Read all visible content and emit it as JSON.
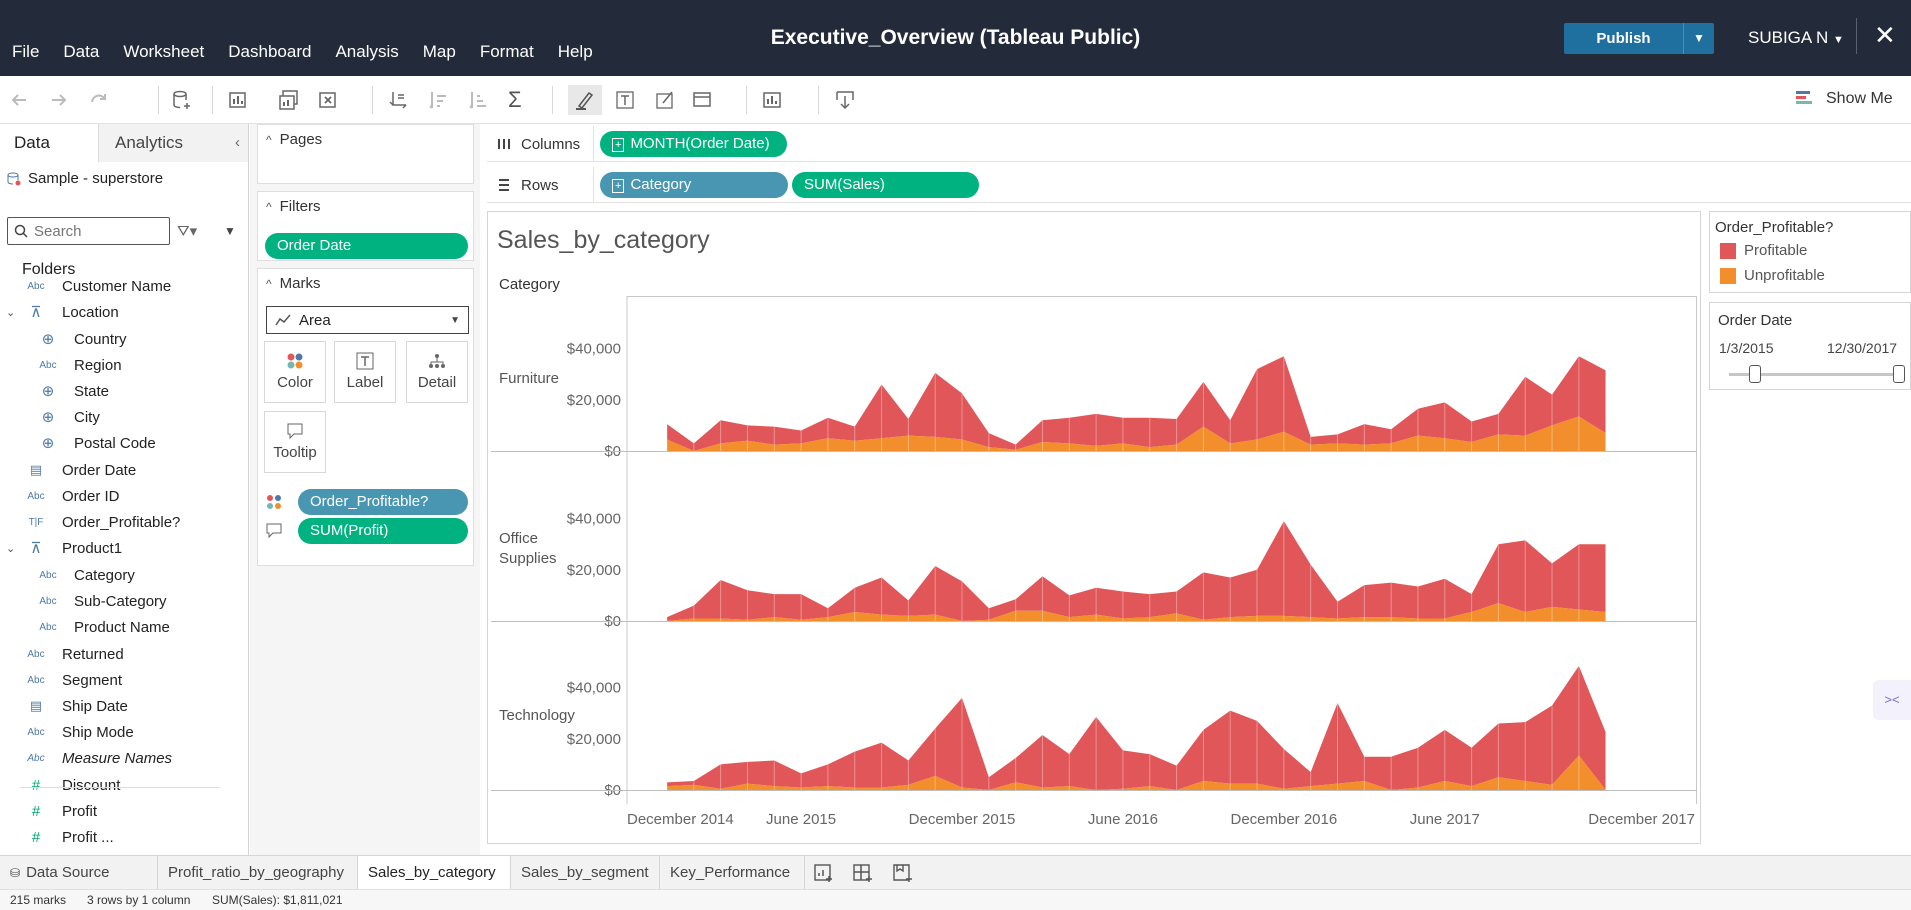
{
  "window": {
    "title": "Executive_Overview (Tableau Public)",
    "publish": "Publish",
    "user": "SUBIGA N"
  },
  "menu": [
    "File",
    "Data",
    "Worksheet",
    "Dashboard",
    "Analysis",
    "Map",
    "Format",
    "Help"
  ],
  "toolbar": {
    "show_me": "Show Me"
  },
  "data_pane": {
    "tabs": [
      "Data",
      "Analytics"
    ],
    "datasource": "Sample - superstore",
    "search_placeholder": "Search",
    "folders_label": "Folders",
    "fields": [
      {
        "icon": "Abc",
        "name": "Customer Name"
      },
      {
        "icon": "hierarchy",
        "name": "Location"
      },
      {
        "icon": "globe",
        "name": "Country"
      },
      {
        "icon": "Abc",
        "name": "Region"
      },
      {
        "icon": "globe",
        "name": "State"
      },
      {
        "icon": "globe",
        "name": "City"
      },
      {
        "icon": "globe",
        "name": "Postal Code"
      },
      {
        "icon": "calendar",
        "name": "Order Date"
      },
      {
        "icon": "Abc",
        "name": "Order ID"
      },
      {
        "icon": "T|F",
        "name": "Order_Profitable?"
      },
      {
        "icon": "hierarchy",
        "name": "Product1"
      },
      {
        "icon": "Abc",
        "name": "Category"
      },
      {
        "icon": "Abc",
        "name": "Sub-Category"
      },
      {
        "icon": "Abc",
        "name": "Product Name"
      },
      {
        "icon": "Abc",
        "name": "Returned"
      },
      {
        "icon": "Abc",
        "name": "Segment"
      },
      {
        "icon": "calendar",
        "name": "Ship Date"
      },
      {
        "icon": "Abc",
        "name": "Ship Mode"
      },
      {
        "icon": "Abc",
        "name": "Measure Names"
      },
      {
        "icon": "#",
        "name": "Discount"
      },
      {
        "icon": "#",
        "name": "Profit"
      },
      {
        "icon": "#",
        "name": "Profit ..."
      }
    ]
  },
  "cards": {
    "pages": "Pages",
    "filters": "Filters",
    "filter_pills": [
      "Order Date"
    ],
    "marks": "Marks",
    "mark_type": "Area",
    "mark_buttons": [
      "Color",
      "Label",
      "Detail",
      "Tooltip"
    ],
    "mark_pills": [
      "Order_Profitable?",
      "SUM(Profit)"
    ]
  },
  "shelves": {
    "columns_label": "Columns",
    "columns": [
      "MONTH(Order Date)"
    ],
    "rows_label": "Rows",
    "rows": [
      "Category",
      "SUM(Sales)"
    ]
  },
  "legend": {
    "title": "Order_Profitable?",
    "items": [
      {
        "label": "Profitable",
        "color": "#e15759"
      },
      {
        "label": "Unprofitable",
        "color": "#f28e2b"
      }
    ]
  },
  "date_filter": {
    "title": "Order Date",
    "min": "1/3/2015",
    "max": "12/30/2017",
    "range_fraction": [
      0.15,
      1.0
    ]
  },
  "sheet_tabs": [
    "Data Source",
    "Profit_ratio_by_geography",
    "Sales_by_category",
    "Sales_by_segment",
    "Key_Performance"
  ],
  "active_tab": "Sales_by_category",
  "status": {
    "marks": "215 marks",
    "shape": "3 rows by 1 column",
    "sum": "SUM(Sales): $1,811,021"
  },
  "chart_data": {
    "type": "area",
    "title": "Sales_by_category",
    "row_header": "Category",
    "x": [
      "Jan 2015",
      "Feb 2015",
      "Mar 2015",
      "Apr 2015",
      "May 2015",
      "Jun 2015",
      "Jul 2015",
      "Aug 2015",
      "Sep 2015",
      "Oct 2015",
      "Nov 2015",
      "Dec 2015",
      "Jan 2016",
      "Feb 2016",
      "Mar 2016",
      "Apr 2016",
      "May 2016",
      "Jun 2016",
      "Jul 2016",
      "Aug 2016",
      "Sep 2016",
      "Oct 2016",
      "Nov 2016",
      "Dec 2016",
      "Jan 2017",
      "Feb 2017",
      "Mar 2017",
      "Apr 2017",
      "May 2017",
      "Jun 2017",
      "Jul 2017",
      "Aug 2017",
      "Sep 2017",
      "Oct 2017",
      "Nov 2017",
      "Dec 2017"
    ],
    "x_ticks": [
      "December 2014",
      "June 2015",
      "December 2015",
      "June 2016",
      "December 2016",
      "June 2017",
      "December 2017"
    ],
    "y_ticks": [
      "$40,000",
      "$20,000",
      "$0"
    ],
    "ylim": [
      0,
      50000
    ],
    "stack": true,
    "panels": [
      {
        "category": "Furniture",
        "series": [
          {
            "name": "Unprofitable",
            "values": [
              4500,
              0,
              3000,
              4000,
              2500,
              3000,
              5000,
              4000,
              5000,
              6000,
              5500,
              4500,
              1500,
              500,
              3500,
              3000,
              2000,
              3000,
              1500,
              2500,
              9500,
              3000,
              4500,
              7500,
              2500,
              3000,
              2500,
              3000,
              6000,
              5000,
              3500,
              6500,
              6000,
              10000,
              13500,
              7000
            ]
          },
          {
            "name": "Profitable",
            "values": [
              6000,
              3000,
              9000,
              6000,
              7000,
              5000,
              8000,
              5500,
              21000,
              6500,
              25000,
              18000,
              5500,
              2000,
              8500,
              10000,
              12500,
              10000,
              11500,
              10000,
              17500,
              9000,
              27500,
              29500,
              3000,
              3500,
              8000,
              5500,
              10500,
              14000,
              8000,
              8000,
              23000,
              12000,
              23500,
              24500
            ]
          }
        ]
      },
      {
        "category": "Office Supplies",
        "series": [
          {
            "name": "Unprofitable",
            "values": [
              0,
              1000,
              1000,
              500,
              1500,
              500,
              1500,
              3500,
              2500,
              2000,
              2500,
              0,
              500,
              4000,
              4000,
              1500,
              2500,
              1000,
              1500,
              3000,
              500,
              1500,
              2000,
              2000,
              1500,
              1000,
              1500,
              1500,
              1000,
              1000,
              3500,
              7000,
              3500,
              5500,
              4500,
              3500
            ]
          },
          {
            "name": "Profitable",
            "values": [
              1500,
              5000,
              15000,
              11500,
              9000,
              10000,
              3500,
              9500,
              14500,
              6000,
              19000,
              15500,
              4500,
              4500,
              13500,
              8500,
              10500,
              10500,
              9000,
              8500,
              18500,
              15500,
              18000,
              37000,
              20500,
              6500,
              12500,
              13500,
              12500,
              15500,
              7000,
              23000,
              28000,
              17000,
              25500,
              26500
            ]
          }
        ]
      },
      {
        "category": "Technology",
        "series": [
          {
            "name": "Unprofitable",
            "values": [
              1500,
              2000,
              500,
              2500,
              1500,
              1000,
              1500,
              1000,
              1000,
              2000,
              5500,
              1000,
              0,
              3000,
              1000,
              1500,
              0,
              500,
              1500,
              0,
              3500,
              2500,
              2500,
              500,
              1500,
              2500,
              3500,
              0,
              1000,
              3500,
              1500,
              5000,
              3500,
              2000,
              13500,
              0
            ]
          },
          {
            "name": "Profitable",
            "values": [
              1500,
              1500,
              9500,
              8500,
              10000,
              5500,
              8500,
              14000,
              17500,
              9500,
              18500,
              35000,
              5000,
              9500,
              20500,
              12500,
              28500,
              15000,
              12500,
              9500,
              20000,
              28500,
              24500,
              15500,
              5500,
              31500,
              9500,
              13000,
              15500,
              20000,
              15000,
              21000,
              23000,
              31000,
              35000,
              22500
            ]
          }
        ]
      }
    ]
  }
}
